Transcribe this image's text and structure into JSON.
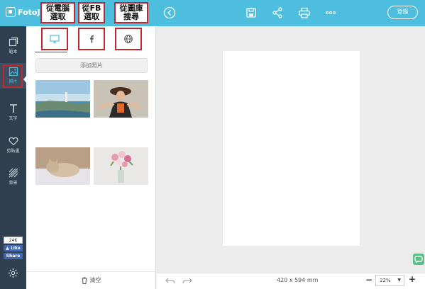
{
  "app": {
    "logo_text": "FotoJ"
  },
  "topbar": {
    "login_label": "登錄"
  },
  "rail": {
    "items": [
      {
        "label": "範本"
      },
      {
        "label": "照片"
      },
      {
        "label": "文字"
      },
      {
        "label": "剪貼畫"
      },
      {
        "label": "背景"
      }
    ]
  },
  "facebook": {
    "count": "24K",
    "like_label": "Like",
    "share_label": "Share"
  },
  "panel": {
    "add_photo_label": "添加照片",
    "clear_label": "清空"
  },
  "callouts": {
    "computer": [
      "從電腦",
      "選取"
    ],
    "fb": [
      "從FB",
      "選取"
    ],
    "library": [
      "從圖庫",
      "搜尋"
    ]
  },
  "canvas": {
    "size_label": "420 x 594 mm"
  },
  "zoom": {
    "value": "22%"
  },
  "colors": {
    "topbar": "#4ebedf",
    "rail": "#2f3f4f",
    "highlight": "#c1272d",
    "accent": "#4ebedf"
  }
}
